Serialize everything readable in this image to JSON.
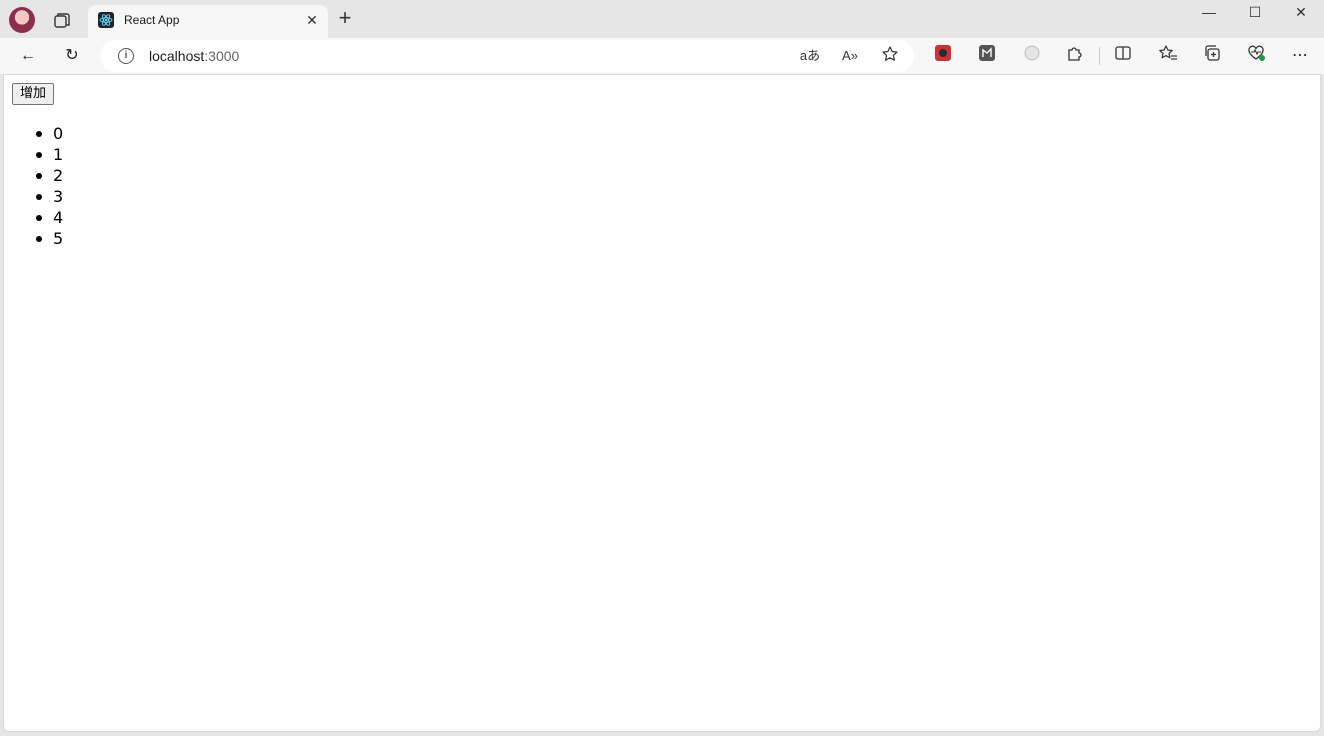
{
  "browser": {
    "tab": {
      "title": "React App",
      "close_glyph": "✕",
      "favicon": "react-icon"
    },
    "new_tab_glyph": "+",
    "window_controls": {
      "minimize": "—",
      "maximize": "☐",
      "close": "✕"
    },
    "toolbar": {
      "back_glyph": "←",
      "refresh_glyph": "↻",
      "address": {
        "host": "localhost",
        "port": ":3000"
      },
      "translate_label": "aあ",
      "read_aloud_label": "A»",
      "more_glyph": "⋯"
    }
  },
  "page": {
    "add_button_label": "增加",
    "items": [
      "0",
      "1",
      "2",
      "3",
      "4",
      "5"
    ]
  }
}
